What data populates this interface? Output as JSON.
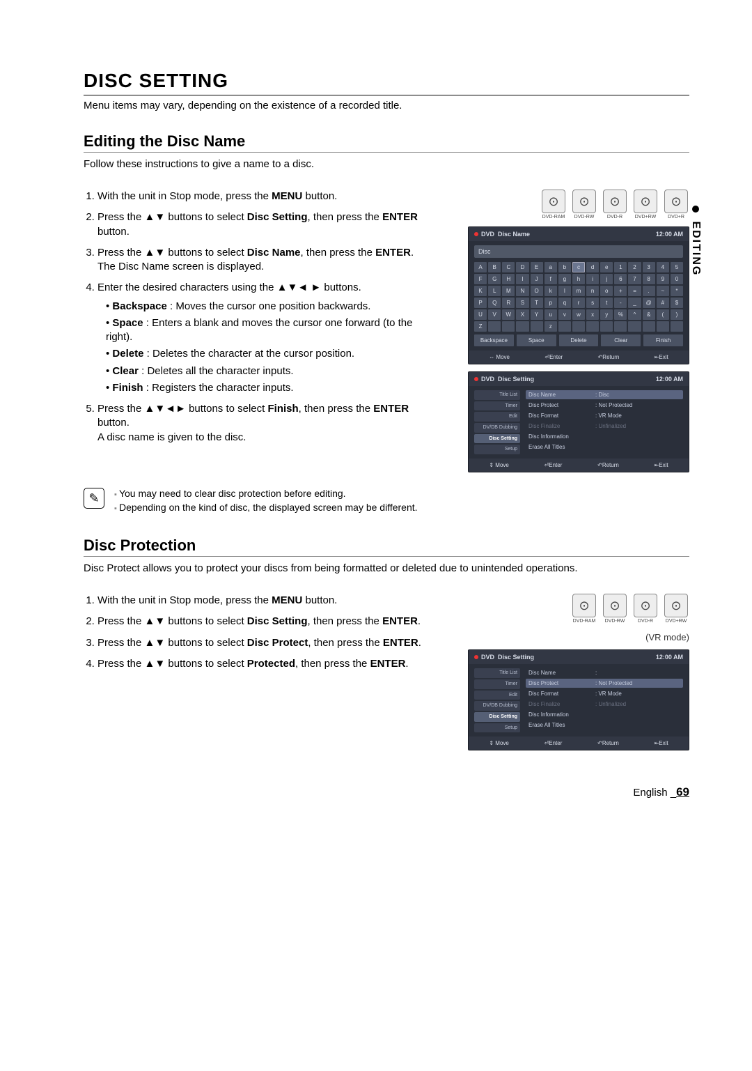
{
  "side_tab": "EDITING",
  "main_heading": "DISC SETTING",
  "main_intro": "Menu items may vary, depending on the existence of a recorded title.",
  "edit_name": {
    "heading": "Editing the Disc Name",
    "intro": "Follow these instructions to give a name to a disc.",
    "disc_types": [
      "DVD-RAM",
      "DVD-RW",
      "DVD-R",
      "DVD+RW",
      "DVD+R"
    ],
    "steps": [
      {
        "prefix": "With the unit in Stop mode, press the ",
        "bold1": "MENU",
        "suffix": " button."
      },
      {
        "prefix": "Press the ▲▼ buttons to select ",
        "bold1": "Disc Setting",
        "mid": ", then press the ",
        "bold2": "ENTER",
        "suffix": " button."
      },
      {
        "prefix": "Press the ▲▼ buttons to select ",
        "bold1": "Disc Name",
        "mid": ", then press the ",
        "bold2": "ENTER",
        "suffix": ".",
        "after": "The Disc Name screen is displayed."
      },
      {
        "prefix": "Enter the desired characters using the ▲▼◄ ► buttons.",
        "bullets": [
          {
            "b": "Backspace",
            "t": " : Moves the cursor one position backwards."
          },
          {
            "b": "Space",
            "t": " : Enters a blank and moves the cursor one forward (to the right)."
          },
          {
            "b": "Delete",
            "t": " : Deletes the character at the cursor position."
          },
          {
            "b": "Clear",
            "t": " : Deletes all the character inputs."
          },
          {
            "b": "Finish",
            "t": " : Registers the character inputs."
          }
        ]
      },
      {
        "prefix": "Press the ▲▼◄► buttons to select ",
        "bold1": "Finish",
        "mid": ", then press the ",
        "bold2": "ENTER",
        "suffix": " button.",
        "after": "A disc name is given to the disc."
      }
    ],
    "notes": [
      "You may need to clear disc protection before editing.",
      "Depending on the kind of disc, the displayed screen may be different."
    ]
  },
  "osd_kbd": {
    "rec_label": "DVD",
    "title": "Disc Name",
    "clock": "12:00 AM",
    "input": "Disc",
    "rows": [
      [
        "A",
        "B",
        "C",
        "D",
        "E",
        "a",
        "b",
        "c",
        "d",
        "e",
        "1",
        "2",
        "3",
        "4",
        "5"
      ],
      [
        "F",
        "G",
        "H",
        "I",
        "J",
        "f",
        "g",
        "h",
        "i",
        "j",
        "6",
        "7",
        "8",
        "9",
        "0"
      ],
      [
        "K",
        "L",
        "M",
        "N",
        "O",
        "k",
        "l",
        "m",
        "n",
        "o",
        "+",
        "=",
        ".",
        "~",
        "*"
      ],
      [
        "P",
        "Q",
        "R",
        "S",
        "T",
        "p",
        "q",
        "r",
        "s",
        "t",
        "-",
        "_",
        "@",
        "#",
        "$"
      ],
      [
        "U",
        "V",
        "W",
        "X",
        "Y",
        "u",
        "v",
        "w",
        "x",
        "y",
        "%",
        "^",
        "&",
        "(",
        ")"
      ],
      [
        "Z",
        "",
        "",
        "",
        "",
        "z",
        "",
        "",
        "",
        "",
        "",
        "",
        "",
        "",
        ""
      ]
    ],
    "hl_key": "c",
    "actions": [
      "Backspace",
      "Space",
      "Delete",
      "Clear",
      "Finish"
    ],
    "foot": [
      "⇔ Move",
      "⏎Enter",
      "↶Return",
      "⇤Exit"
    ]
  },
  "osd_menu1": {
    "rec_label": "DVD",
    "title": "Disc Setting",
    "clock": "12:00 AM",
    "side": [
      "Title List",
      "Timer",
      "Edit",
      "DV/DB Dubbing",
      "Disc Setting",
      "Setup"
    ],
    "active_side": "Disc Setting",
    "options": [
      {
        "k": "Disc Name",
        "v": ": Disc",
        "hl": true
      },
      {
        "k": "Disc Protect",
        "v": ": Not Protected"
      },
      {
        "k": "Disc Format",
        "v": ": VR Mode"
      },
      {
        "k": "Disc Finalize",
        "v": ": Unfinalized",
        "dim": true
      },
      {
        "k": "Disc Information",
        "v": ""
      },
      {
        "k": "Erase All Titles",
        "v": ""
      }
    ],
    "foot": [
      "⇕ Move",
      "⏎Enter",
      "↶Return",
      "⇤Exit"
    ]
  },
  "disc_protect": {
    "heading": "Disc Protection",
    "intro": "Disc Protect allows you to protect your discs from being formatted or deleted due to unintended operations.",
    "disc_types": [
      "DVD-RAM",
      "DVD-RW",
      "DVD-R",
      "DVD+RW"
    ],
    "vr_mode": "(VR mode)",
    "steps": [
      {
        "prefix": "With the unit in Stop mode, press the ",
        "bold1": "MENU",
        "suffix": " button."
      },
      {
        "prefix": "Press the ▲▼ buttons to select ",
        "bold1": "Disc Setting",
        "mid": ", then press the ",
        "bold2": "ENTER",
        "suffix": "."
      },
      {
        "prefix": "Press the ▲▼ buttons to select ",
        "bold1": "Disc Protect",
        "mid": ", then press the ",
        "bold2": "ENTER",
        "suffix": "."
      },
      {
        "prefix": "Press the ▲▼ buttons to select ",
        "bold1": "Protected",
        "mid": ", then press the ",
        "bold2": "ENTER",
        "suffix": "."
      }
    ]
  },
  "osd_menu2": {
    "rec_label": "DVD",
    "title": "Disc Setting",
    "clock": "12:00 AM",
    "side": [
      "Title List",
      "Timer",
      "Edit",
      "DV/DB Dubbing",
      "Disc Setting",
      "Setup"
    ],
    "active_side": "Disc Setting",
    "options": [
      {
        "k": "Disc Name",
        "v": ":"
      },
      {
        "k": "Disc Protect",
        "v": ": Not Protected",
        "hl": true
      },
      {
        "k": "Disc Format",
        "v": ": VR Mode"
      },
      {
        "k": "Disc Finalize",
        "v": ": Unfinalized",
        "dim": true
      },
      {
        "k": "Disc Information",
        "v": ""
      },
      {
        "k": "Erase All Titles",
        "v": ""
      }
    ],
    "foot": [
      "⇕ Move",
      "⏎Enter",
      "↶Return",
      "⇤Exit"
    ]
  },
  "footer": {
    "lang": "English",
    "sep": " _",
    "page": "69"
  }
}
